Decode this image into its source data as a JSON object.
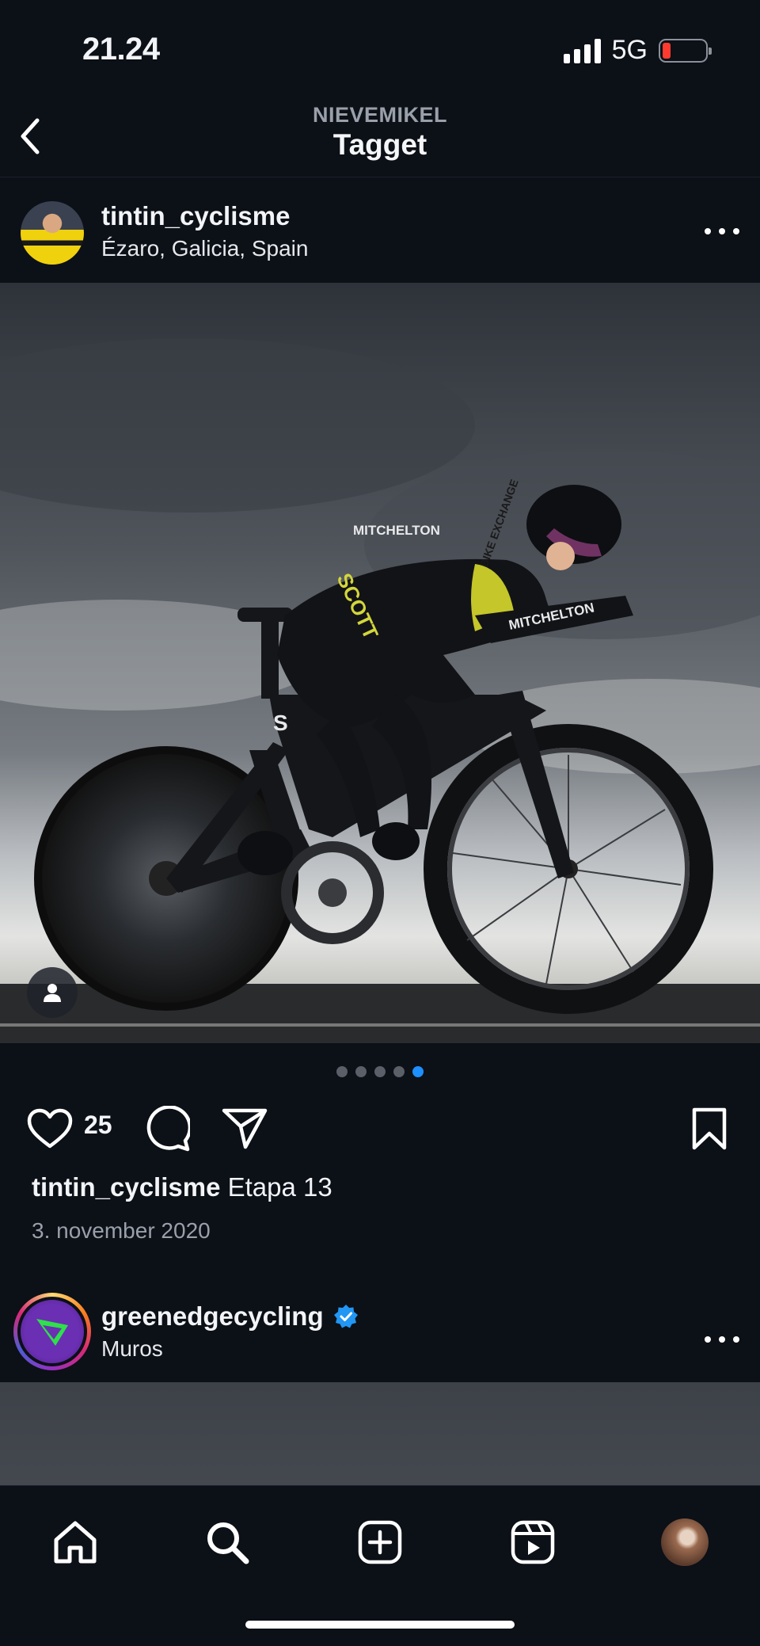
{
  "status_bar": {
    "time": "21.24",
    "network": "5G",
    "battery_level": 0.1,
    "battery_color": "#ff3b30"
  },
  "header": {
    "subtitle": "NIEVEMIKEL",
    "title": "Tagget",
    "back_icon": "chevron-left-icon"
  },
  "post": {
    "username": "tintin_cyclisme",
    "location": "Ézaro, Galicia, Spain",
    "likes": "25",
    "caption_user": "tintin_cyclisme",
    "caption_text": "Etapa 13",
    "date": "3. november 2020",
    "carousel_count": 5,
    "carousel_active_index": 4,
    "image_text": {
      "chest": "MITCHELTON",
      "shorts": "SCOTT",
      "sleeve": "MITCHELTON",
      "side": "BIKE EXCHANGE"
    }
  },
  "next_post": {
    "username": "greenedgecycling",
    "location": "Muros",
    "verified": true
  },
  "bottom_nav": {
    "items": [
      "home-icon",
      "search-icon",
      "create-icon",
      "reels-icon",
      "profile-avatar"
    ]
  },
  "colors": {
    "background": "#0c1017",
    "accent": "#1e8fff",
    "verified": "#2196f3"
  }
}
